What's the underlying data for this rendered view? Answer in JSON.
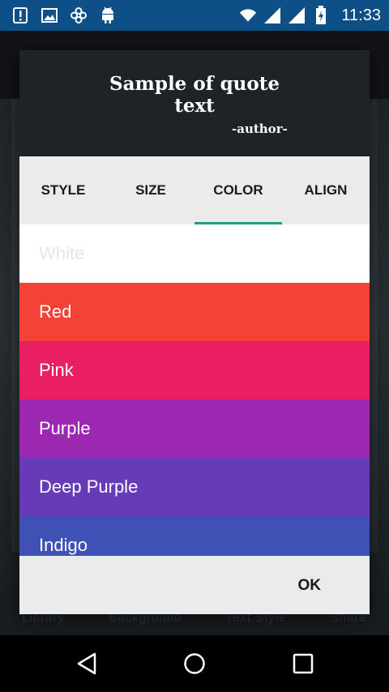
{
  "status_bar": {
    "time": "11:33",
    "icons": [
      "alert-icon",
      "image-icon",
      "settings-flower-icon",
      "android-icon",
      "wifi-icon",
      "signal-icon",
      "signal-icon-2",
      "battery-icon"
    ]
  },
  "background_app": {
    "tabs": [
      "Library",
      "Background",
      "Text Style",
      "Share"
    ]
  },
  "dialog": {
    "quote_text": "Sample of quote text",
    "author": "-author-",
    "tabs": [
      {
        "label": "STYLE",
        "active": false
      },
      {
        "label": "SIZE",
        "active": false
      },
      {
        "label": "COLOR",
        "active": true
      },
      {
        "label": "ALIGN",
        "active": false
      }
    ],
    "colors": [
      {
        "label": "White",
        "hex": "#ffffff",
        "text": "#e6e6e6"
      },
      {
        "label": "Red",
        "hex": "#f44336",
        "text": "#ffffff"
      },
      {
        "label": "Pink",
        "hex": "#e91e63",
        "text": "#ffffff"
      },
      {
        "label": "Purple",
        "hex": "#9c27b0",
        "text": "#ffffff"
      },
      {
        "label": "Deep Purple",
        "hex": "#673ab7",
        "text": "#ffffff"
      },
      {
        "label": "Indigo",
        "hex": "#3f51b5",
        "text": "#ffffff"
      }
    ],
    "ok_label": "OK",
    "accent": "#1b9e8a"
  }
}
